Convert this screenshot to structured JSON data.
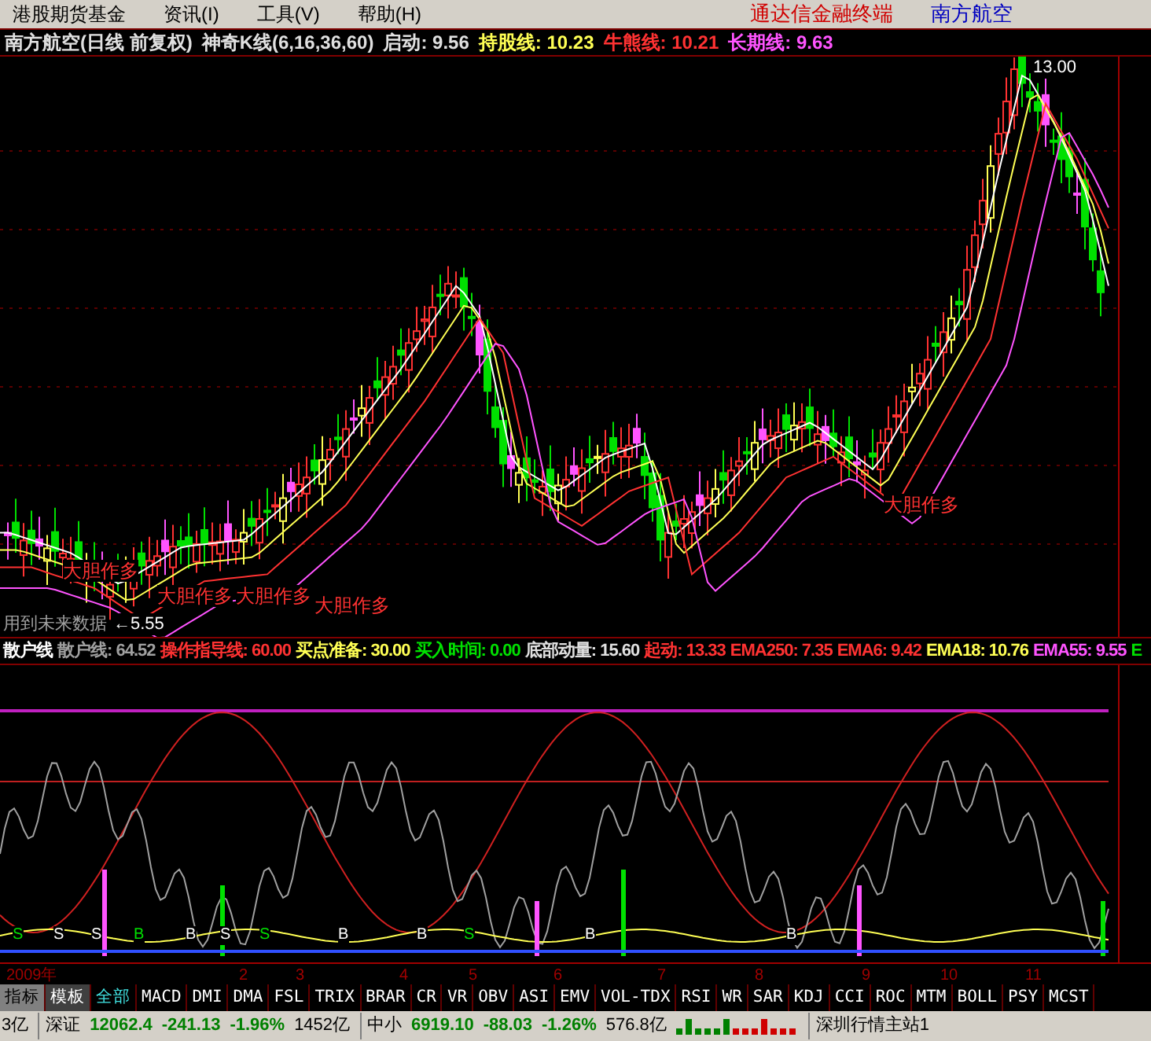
{
  "menu": {
    "items": [
      "港股期货基金",
      "资讯(I)",
      "工具(V)",
      "帮助(H)"
    ],
    "brand": "通达信金融终端",
    "stock": "南方航空"
  },
  "chart_header": [
    {
      "text": "南方航空(日线 前复权)",
      "color": "#e0e0e0"
    },
    {
      "text": "神奇K线(6,16,36,60)",
      "color": "#e0e0e0"
    },
    {
      "text": "启动: 9.56",
      "color": "#e0e0e0"
    },
    {
      "text": "持股线: 10.23",
      "color": "#ffff54"
    },
    {
      "text": "牛熊线: 10.21",
      "color": "#ff3232"
    },
    {
      "text": "长期线: 9.63",
      "color": "#ff54ff"
    }
  ],
  "chart_annotations": [
    {
      "text": "13.00"
    },
    {
      "text": "←5.55"
    },
    {
      "text": "大胆作多"
    },
    {
      "text": "大胆作多"
    },
    {
      "text": "大胆作多"
    },
    {
      "text": "大胆作多"
    },
    {
      "text": "大胆作多"
    },
    {
      "text": "用到未来数据"
    }
  ],
  "indicator_header": [
    {
      "text": "散户线",
      "color": "#ffffff"
    },
    {
      "text": "散户线: 64.52",
      "color": "#a0a0a0"
    },
    {
      "text": "操作指导线: 60.00",
      "color": "#ff3232"
    },
    {
      "text": "买点准备: 30.00",
      "color": "#ffff54"
    },
    {
      "text": "买入时间: 0.00",
      "color": "#00e000"
    },
    {
      "text": "底部动量: 15.60",
      "color": "#e0e0e0"
    },
    {
      "text": "起动: 13.33",
      "color": "#ff3232"
    },
    {
      "text": "EMA250: 7.35",
      "color": "#ff3232"
    },
    {
      "text": "EMA6: 9.42",
      "color": "#ff3232"
    },
    {
      "text": "EMA18: 10.76",
      "color": "#ffff54"
    },
    {
      "text": "EMA55: 9.55",
      "color": "#ff54ff"
    },
    {
      "text": "E",
      "color": "#00e000"
    }
  ],
  "signals": [
    "S",
    "S",
    "S",
    "B",
    "B",
    "S",
    "S",
    "B",
    "B",
    "S",
    "B",
    "B"
  ],
  "x_axis": [
    "2009年",
    "2",
    "3",
    "4",
    "5",
    "6",
    "7",
    "8",
    "9",
    "10",
    "11"
  ],
  "tabs": [
    {
      "label": "指标",
      "selected": true
    },
    {
      "label": "模板",
      "selected": false
    },
    {
      "label": "全部",
      "selected": true
    },
    {
      "label": "MACD",
      "selected": false
    },
    {
      "label": "DMI",
      "selected": false
    },
    {
      "label": "DMA",
      "selected": false
    },
    {
      "label": "FSL",
      "selected": false
    },
    {
      "label": "TRIX",
      "selected": false
    },
    {
      "label": "BRAR",
      "selected": false
    },
    {
      "label": "CR",
      "selected": false
    },
    {
      "label": "VR",
      "selected": false
    },
    {
      "label": "OBV",
      "selected": false
    },
    {
      "label": "ASI",
      "selected": false
    },
    {
      "label": "EMV",
      "selected": false
    },
    {
      "label": "VOL-TDX",
      "selected": false
    },
    {
      "label": "RSI",
      "selected": false
    },
    {
      "label": "WR",
      "selected": false
    },
    {
      "label": "SAR",
      "selected": false
    },
    {
      "label": "KDJ",
      "selected": false
    },
    {
      "label": "CCI",
      "selected": false
    },
    {
      "label": "ROC",
      "selected": false
    },
    {
      "label": "MTM",
      "selected": false
    },
    {
      "label": "BOLL",
      "selected": false
    },
    {
      "label": "PSY",
      "selected": false
    },
    {
      "label": "MCST",
      "selected": false
    }
  ],
  "status_bar": {
    "partial": "3亿",
    "indices": [
      {
        "name": "深证",
        "value": "12062.4",
        "change": "-241.13",
        "percent": "-1.96%",
        "amount": "1452亿"
      },
      {
        "name": "中小",
        "value": "6919.10",
        "change": "-88.03",
        "percent": "-1.26%",
        "amount": "576.8亿"
      }
    ],
    "server": "深圳行情主站1"
  }
}
